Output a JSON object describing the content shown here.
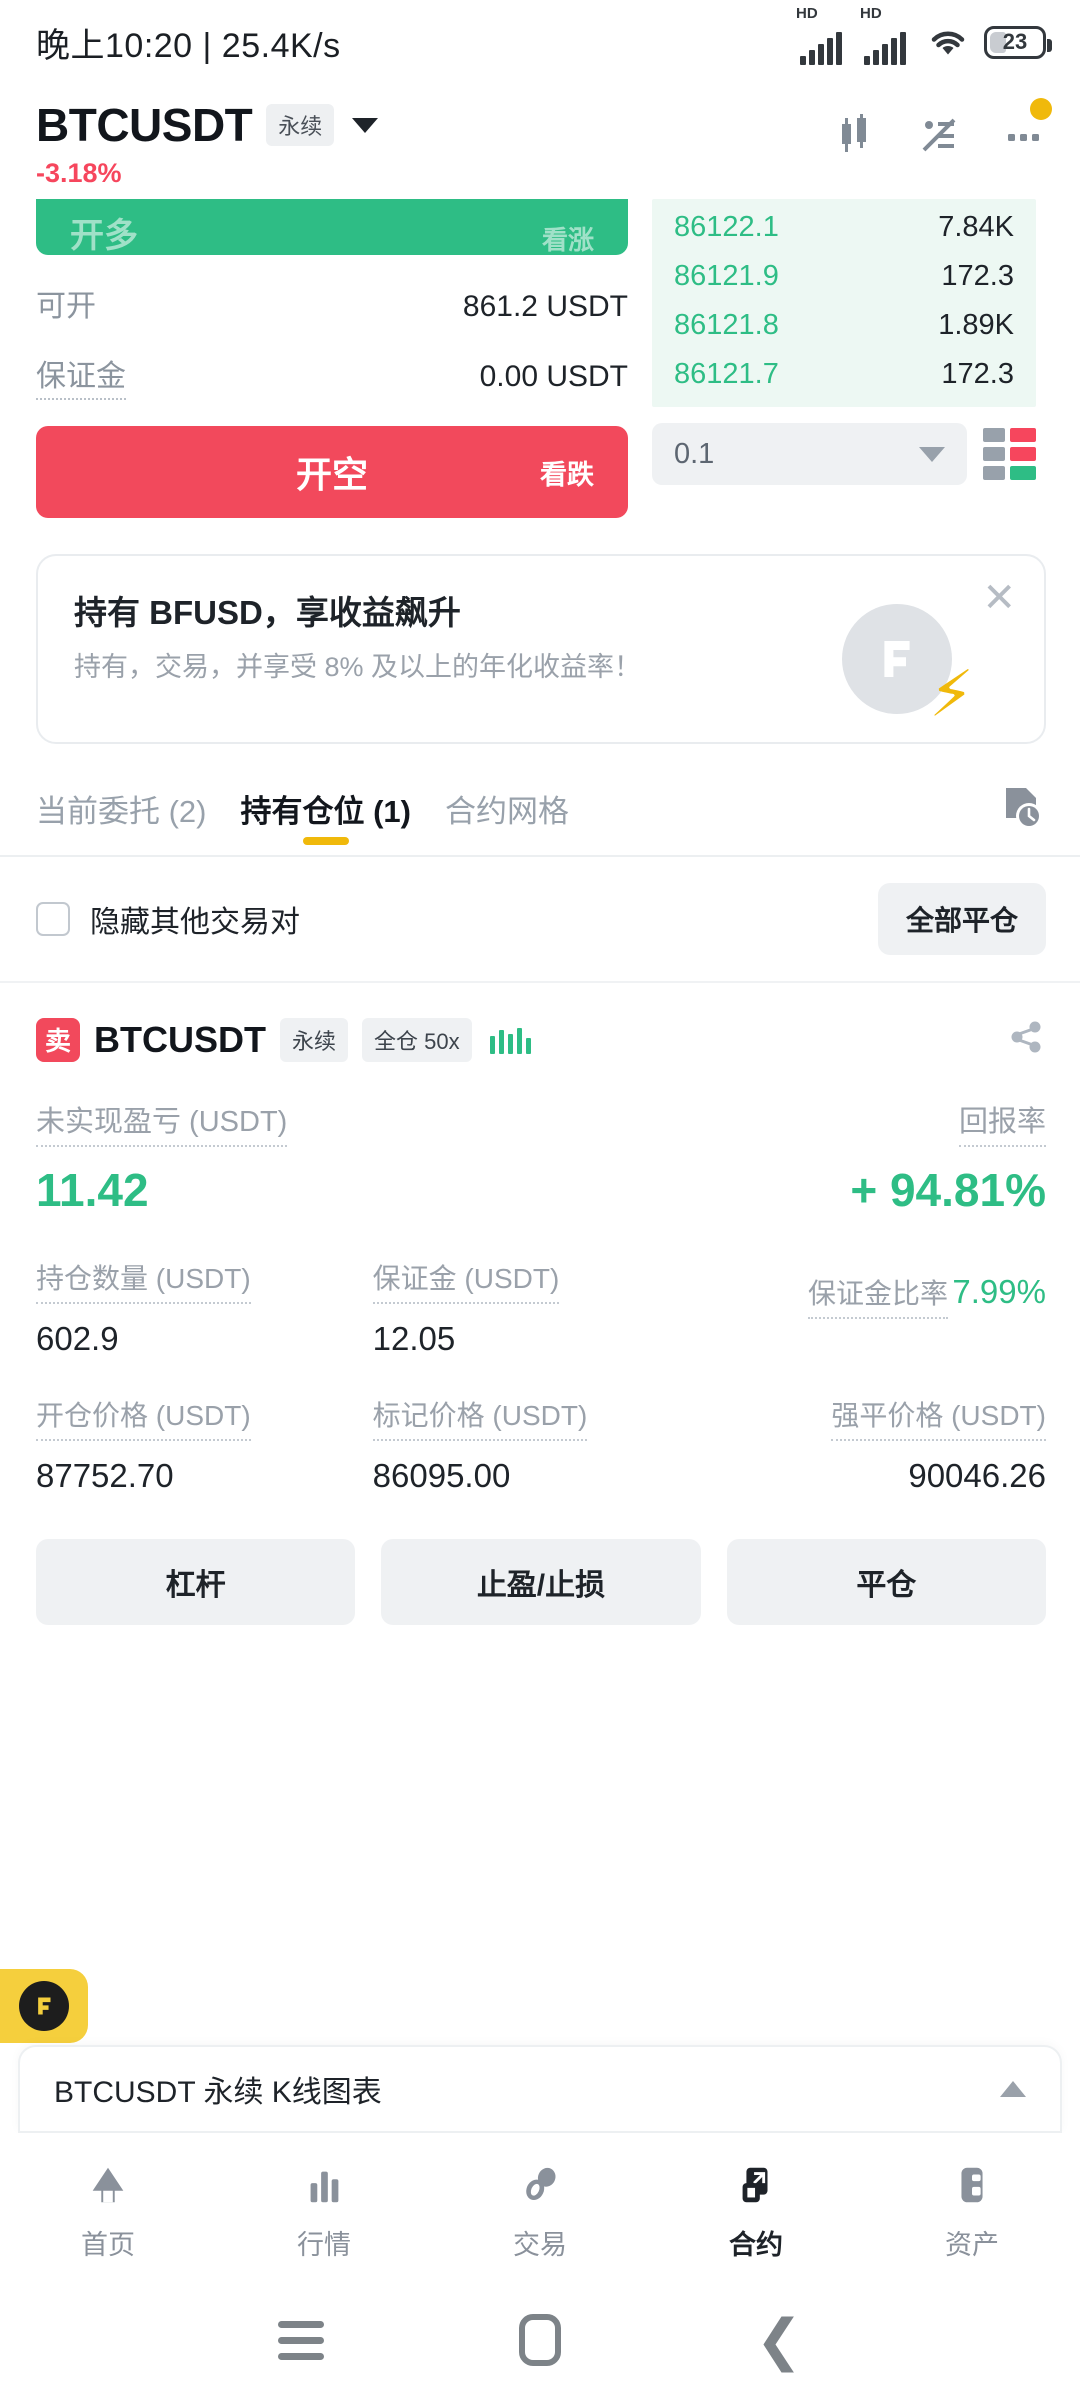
{
  "statusbar": {
    "time_text": "晚上10:20 | 25.4K/s",
    "signal1_label": "HD",
    "signal2_label": "HD",
    "wifi_icon": "wifi-icon",
    "battery_level": "23"
  },
  "header": {
    "symbol": "BTCUSDT",
    "contract_type": "永续",
    "change_pct": "-3.18%",
    "icons": [
      "candlestick-chart-icon",
      "order-settings-icon",
      "more-options-icon"
    ]
  },
  "trade": {
    "long_button": {
      "label": "开多",
      "sub_label": "看涨"
    },
    "available": {
      "label": "可开",
      "value": "861.2 USDT"
    },
    "margin": {
      "label": "保证金",
      "value": "0.00 USDT"
    },
    "short_button": {
      "label": "开空",
      "sub_label": "看跌"
    },
    "orderbook": {
      "rows": [
        {
          "price": "86122.1",
          "qty": "7.84K"
        },
        {
          "price": "86121.9",
          "qty": "172.3"
        },
        {
          "price": "86121.8",
          "qty": "1.89K"
        },
        {
          "price": "86121.7",
          "qty": "172.3"
        }
      ],
      "tick_size": "0.1",
      "depth_toggle_icon": "orderbook-layout-icon"
    }
  },
  "promo": {
    "title": "持有 BFUSD，享收益飙升",
    "subtitle": "持有，交易，并享受 8% 及以上的年化收益率！",
    "close_icon": "close-icon",
    "art_icon": "bfusd-bolt-icon"
  },
  "tabs": {
    "items": [
      {
        "label": "当前委托 (2)",
        "active": false
      },
      {
        "label": "持有仓位 (1)",
        "active": true
      },
      {
        "label": "合约网格",
        "active": false
      }
    ],
    "history_icon": "order-history-icon"
  },
  "filter": {
    "hide_others_label": "隐藏其他交易对",
    "hide_others_checked": false,
    "close_all_label": "全部平仓"
  },
  "position": {
    "side_badge": "卖",
    "symbol": "BTCUSDT",
    "contract_type": "永续",
    "margin_mode": "全仓 50x",
    "share_icon": "share-icon",
    "pnl": {
      "label": "未实现盈亏 (USDT)",
      "value": "11.42"
    },
    "roe": {
      "label": "回报率",
      "value": "+ 94.81%"
    },
    "stats": [
      {
        "label": "持仓数量 (USDT)",
        "value": "602.9",
        "align": "left",
        "green": false
      },
      {
        "label": "保证金 (USDT)",
        "value": "12.05",
        "align": "left",
        "green": false
      },
      {
        "label": "保证金比率",
        "value": "7.99%",
        "align": "right",
        "green": true
      },
      {
        "label": "开仓价格 (USDT)",
        "value": "87752.70",
        "align": "left",
        "green": false
      },
      {
        "label": "标记价格 (USDT)",
        "value": "86095.00",
        "align": "left",
        "green": false
      },
      {
        "label": "强平价格 (USDT)",
        "value": "90046.26",
        "align": "right",
        "green": false
      }
    ],
    "actions": [
      "杠杆",
      "止盈/止损",
      "平仓"
    ]
  },
  "kline_bar": {
    "title": "BTCUSDT 永续 K线图表",
    "expand_icon": "chevron-up-icon",
    "fab_icon": "binance-logo-icon"
  },
  "bottom_nav": [
    {
      "label": "首页",
      "icon": "home-icon",
      "active": false
    },
    {
      "label": "行情",
      "icon": "markets-bars-icon",
      "active": false
    },
    {
      "label": "交易",
      "icon": "trade-swap-icon",
      "active": false
    },
    {
      "label": "合约",
      "icon": "futures-icon",
      "active": true
    },
    {
      "label": "资产",
      "icon": "assets-wallet-icon",
      "active": false
    }
  ],
  "system_nav": [
    {
      "icon": "menu-icon"
    },
    {
      "icon": "home-square-icon"
    },
    {
      "icon": "back-chevron-icon"
    }
  ],
  "colors": {
    "green": "#2ebd85",
    "red": "#f2495c",
    "accent_yellow": "#f0b90b",
    "muted": "#9aa1aa"
  }
}
